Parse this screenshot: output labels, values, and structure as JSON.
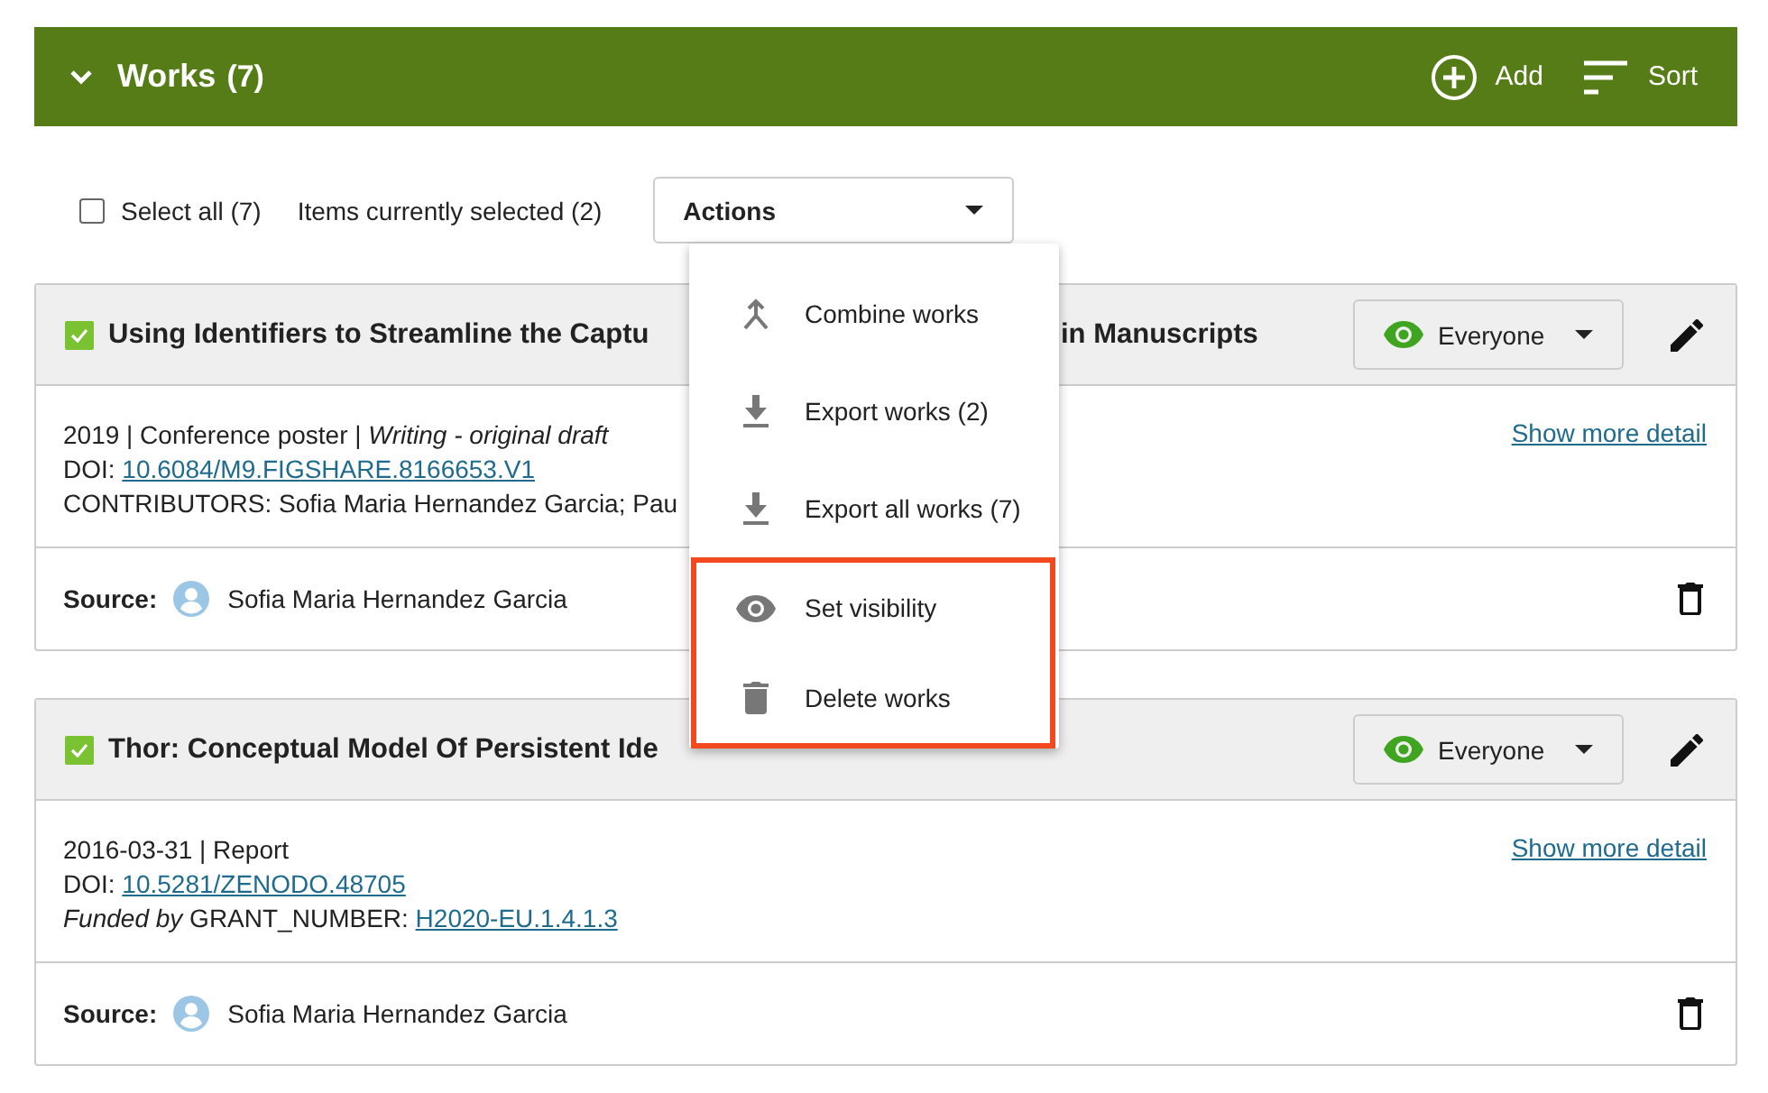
{
  "header": {
    "title": "Works",
    "count": "(7)",
    "expanded": true,
    "actions": [
      {
        "kind": "add",
        "label": "Add"
      },
      {
        "kind": "sort",
        "label": "Sort"
      }
    ]
  },
  "toolbar": {
    "select_all": {
      "label": "Select all (7)",
      "checked": false
    },
    "selected_info": "Items currently selected (2)",
    "actions_button": {
      "label": "Actions",
      "expanded": true
    }
  },
  "menu": [
    {
      "kind": "combine",
      "label": "Combine works",
      "highlighted": false
    },
    {
      "kind": "export",
      "label": "Export works (2)",
      "highlighted": false
    },
    {
      "kind": "export",
      "label": "Export all works (7)",
      "highlighted": false
    },
    {
      "kind": "visibility",
      "label": "Set visibility",
      "highlighted": true
    },
    {
      "kind": "delete",
      "label": "Delete works",
      "highlighted": true
    }
  ],
  "works": [
    {
      "checked": true,
      "title_parts": [
        "Using Identifiers to Streamline the Captu",
        "in Manuscripts"
      ],
      "visibility": "Everyone",
      "show_more": "Show more detail",
      "source_label": "Source:",
      "source": "Sofia Maria Hernandez Garcia",
      "lines": [
        [
          {
            "kind": "text",
            "text": "2019 | Conference poster | "
          },
          {
            "kind": "role",
            "text": "Writing - original draft"
          }
        ],
        [
          {
            "kind": "text",
            "text": "DOI: "
          },
          {
            "kind": "link",
            "text": "10.6084/M9.FIGSHARE.8166653.V1"
          }
        ],
        [
          {
            "kind": "text",
            "text": "CONTRIBUTORS: Sofia Maria Hernandez Garcia; Pau"
          }
        ]
      ]
    },
    {
      "checked": true,
      "title_parts": [
        "Thor: Conceptual Model Of Persistent Ide"
      ],
      "visibility": "Everyone",
      "show_more": "Show more detail",
      "source_label": "Source:",
      "source": "Sofia Maria Hernandez Garcia",
      "lines": [
        [
          {
            "kind": "text",
            "text": "2016-03-31 | Report"
          }
        ],
        [
          {
            "kind": "text",
            "text": "DOI: "
          },
          {
            "kind": "link",
            "text": "10.5281/ZENODO.48705"
          }
        ],
        [
          {
            "kind": "role",
            "text": "Funded by"
          },
          {
            "kind": "text",
            "text": " GRANT_NUMBER: "
          },
          {
            "kind": "link",
            "text": "H2020-EU.1.4.1.3"
          }
        ]
      ]
    }
  ]
}
